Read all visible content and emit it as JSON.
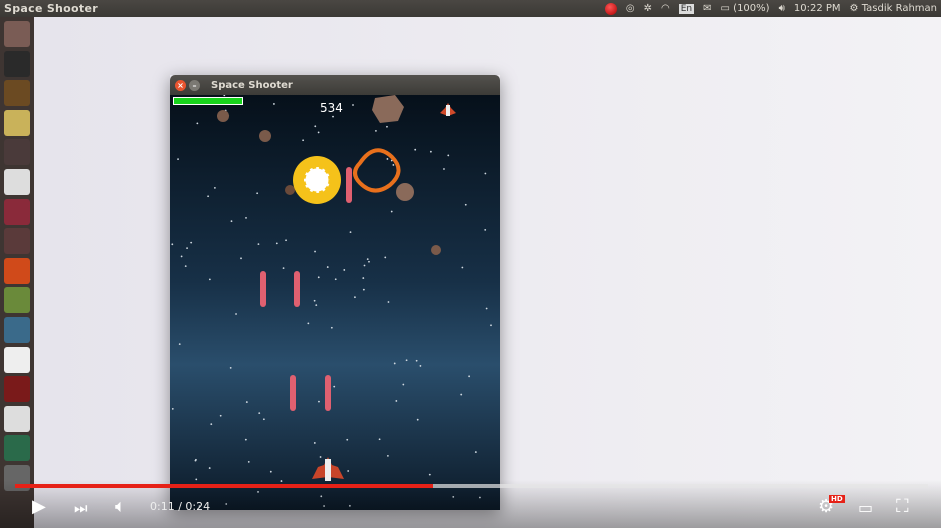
{
  "topbar": {
    "app_title": "Space Shooter",
    "lang": "En",
    "battery": "(100%)",
    "time": "10:22 PM",
    "user": "Tasdik Rahman"
  },
  "launcher": [
    "ubuntu-dash",
    "terminal",
    "sublime-text",
    "chrome",
    "firefox",
    "mysql-workbench",
    "files",
    "system-settings",
    "software-center",
    "libreoffice-calc",
    "virtualbox",
    "text-editor",
    "gnome-cards",
    "latex",
    "globe-browser",
    "help"
  ],
  "window": {
    "title": "Space Shooter",
    "close": "×",
    "min": "–"
  },
  "game": {
    "score": "534",
    "health_fraction": 1.0
  },
  "player": {
    "current_time": "0:11",
    "duration": "0:24",
    "time_display": "0:11 / 0:24",
    "progress_fraction": 0.458,
    "hd_badge": "HD",
    "colors": {
      "progress": "#e62117"
    }
  }
}
